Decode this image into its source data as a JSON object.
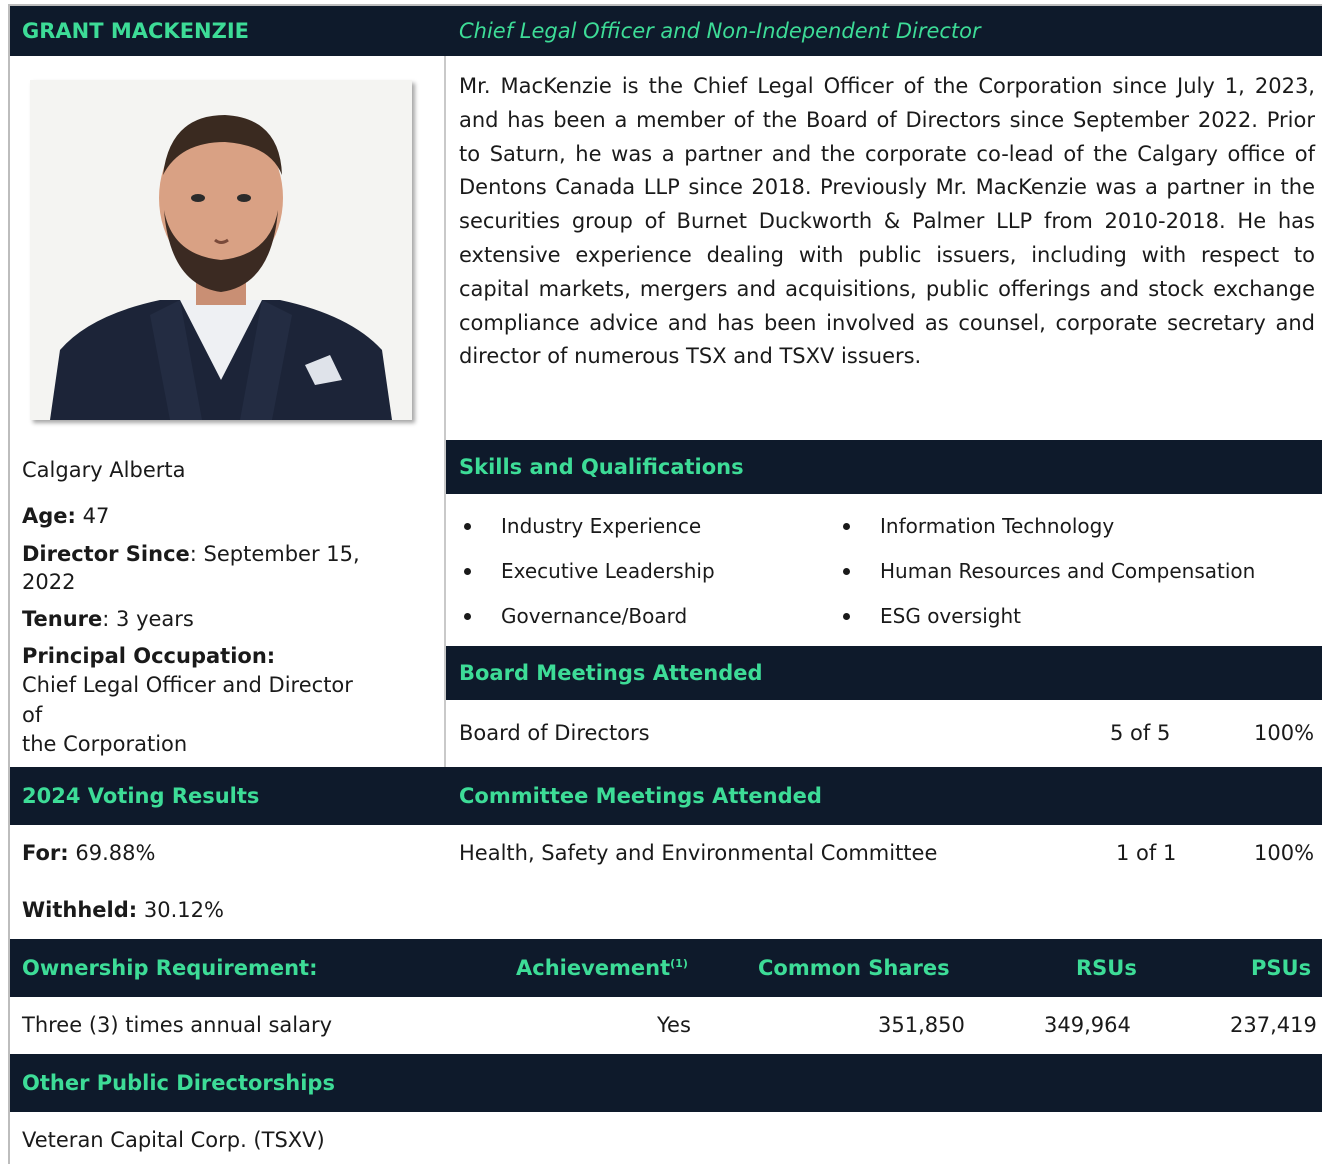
{
  "header": {
    "name": "GRANT MACKENZIE",
    "role": "Chief Legal Officer and Non-Independent Director"
  },
  "photo": {
    "alt": "Portrait of Grant MacKenzie"
  },
  "bio": "Mr. MacKenzie is the Chief Legal Officer of the Corporation since July 1, 2023, and has been a member of the Board of Directors since September 2022.  Prior to Saturn, he was a partner and the corporate co-lead of the Calgary office of Dentons Canada LLP since 2018. Previously Mr. MacKenzie was a partner in the securities group of Burnet Duckworth & Palmer LLP from 2010-2018. He has extensive experience dealing with public issuers, including with respect to capital markets, mergers and acquisitions, public offerings and stock exchange compliance advice and has been involved as counsel, corporate secretary and director of numerous TSX and TSXV issuers.",
  "profile": {
    "location": "Calgary Alberta",
    "age_label": "Age:",
    "age_value": " 47",
    "director_since_label": "Director Since",
    "director_since_value_1": ": September 15,",
    "director_since_value_2": "2022",
    "tenure_label": "Tenure",
    "tenure_value": ": 3 years",
    "occupation_label": "Principal Occupation:",
    "occupation_line_1": "Chief Legal Officer and Director",
    "occupation_line_2": "of",
    "occupation_line_3": "the Corporation"
  },
  "skills": {
    "heading": "Skills and Qualifications",
    "left": [
      "Industry Experience",
      "Executive Leadership",
      "Governance/Board"
    ],
    "right": [
      "Information Technology",
      "Human Resources and Compensation",
      "ESG oversight"
    ]
  },
  "board_meetings": {
    "heading": "Board Meetings Attended",
    "name": "Board of Directors",
    "count": "5 of 5",
    "percent": "100%"
  },
  "voting": {
    "heading": "2024 Voting Results",
    "for_label": "For:",
    "for_value": " 69.88%",
    "withheld_label": "Withheld:",
    "withheld_value": " 30.12%"
  },
  "committee_meetings": {
    "heading": "Committee Meetings Attended",
    "name": "Health, Safety and Environmental Committee",
    "count": "1 of 1",
    "percent": "100%"
  },
  "ownership": {
    "headers": {
      "requirement": "Ownership Requirement:",
      "achievement": "Achievement",
      "achievement_note": "(1)",
      "common_shares": "Common Shares",
      "rsus": "RSUs",
      "psus": "PSUs"
    },
    "row": {
      "requirement": "Three (3) times annual salary",
      "achievement": "Yes",
      "common_shares": "351,850",
      "rsus": "349,964",
      "psus": "237,419"
    }
  },
  "other_directorships": {
    "heading": "Other Public Directorships",
    "items": [
      "Veteran Capital Corp. (TSXV)"
    ]
  },
  "colors": {
    "bar_bg": "#0e1a2b",
    "accent": "#3ddc97"
  }
}
